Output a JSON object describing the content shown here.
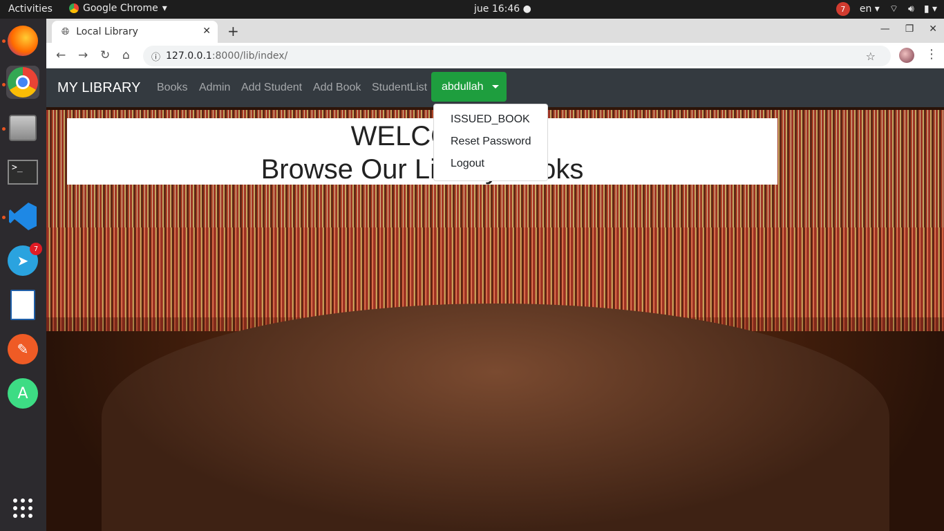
{
  "system": {
    "activities": "Activities",
    "app_name": "Google Chrome",
    "clock": "jue 16:46",
    "lang": "en",
    "tray_badge": "7"
  },
  "dock": {
    "telegram_badge": "7",
    "items": [
      "firefox-icon",
      "chrome-icon",
      "files-icon",
      "terminal-icon",
      "vscode-icon",
      "telegram-icon",
      "writer-icon",
      "postman-icon",
      "android-studio-icon",
      "apps-grid-icon"
    ]
  },
  "browser": {
    "tab_title": "Local Library",
    "url_host": "127.0.0.1",
    "url_path": ":8000/lib/index/"
  },
  "navbar": {
    "brand": "MY LIBRARY",
    "links": [
      "Books",
      "Admin",
      "Add Student",
      "Add Book",
      "StudentList"
    ],
    "user": "abdullah"
  },
  "dropdown": {
    "items": [
      "ISSUED_BOOK",
      "Reset Password",
      "Logout"
    ]
  },
  "hero": {
    "line1": "WELCOME",
    "line2": "Browse Our Library Books"
  }
}
